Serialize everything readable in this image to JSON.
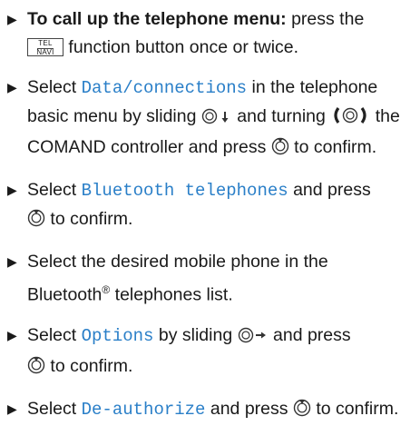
{
  "icons": {
    "bullet": "▶",
    "controller": "controller-icon",
    "press": "press-controller-icon"
  },
  "accent_color": "#2a7fc8",
  "tel_navi_button": {
    "top": "TEL",
    "bottom": "NAVI"
  },
  "steps": [
    {
      "bold": "To call up the telephone menu:",
      "t1": " press the",
      "t2": "function button once or twice."
    },
    {
      "t1": "Select ",
      "menu": "Data/connections",
      "t2": " in the telephone basic menu by sliding ",
      "t3": " and turning ",
      "t4": " the COMAND controller and press ",
      "t5": " to confirm."
    },
    {
      "t1": "Select ",
      "menu": "Bluetooth telephones",
      "t2": " and press",
      "t3": " to confirm."
    },
    {
      "t1": "Select the desired mobile phone in the Bluetooth",
      "sup": "®",
      "t2": " telephones list."
    },
    {
      "t1": "Select ",
      "menu": "Options",
      "t2": " by sliding ",
      "t3": " and press",
      "t4": " to confirm."
    },
    {
      "t1": "Select ",
      "menu": "De-authorize",
      "t2": " and press ",
      "t3": " to confirm."
    }
  ]
}
